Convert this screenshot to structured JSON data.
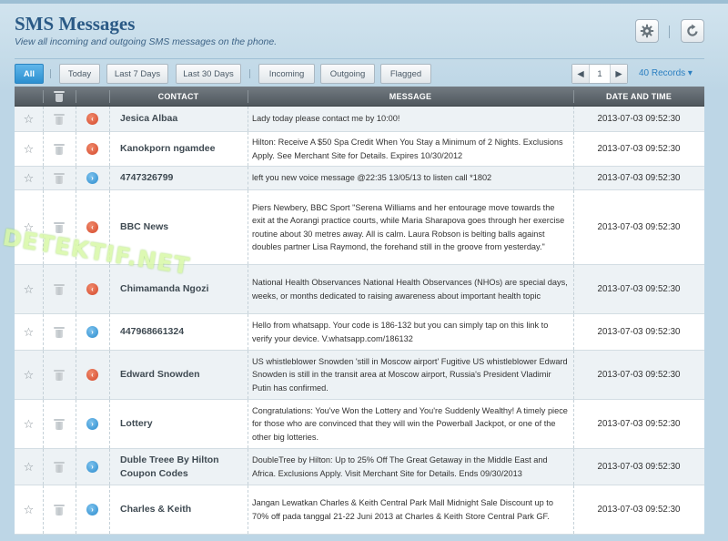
{
  "header": {
    "title": "SMS Messages",
    "subtitle": "View all incoming and outgoing SMS messages on the phone."
  },
  "icons": {
    "settings": "gear-icon",
    "refresh": "refresh-icon",
    "star": "star-icon",
    "trash": "trash-icon",
    "incoming": "incoming-arrow-icon",
    "outgoing": "outgoing-arrow-icon"
  },
  "colors": {
    "accent": "#2c8fd0",
    "incoming": "#d4472a",
    "outgoing": "#2b8bcd",
    "title": "#2b5a86"
  },
  "filters": {
    "all": "All",
    "today": "Today",
    "last7": "Last 7 Days",
    "last30": "Last 30 Days",
    "incoming": "Incoming",
    "outgoing": "Outgoing",
    "flagged": "Flagged",
    "active": "All"
  },
  "pager": {
    "page": "1",
    "records": "40 Records ▾"
  },
  "table": {
    "columns": {
      "contact": "CONTACT",
      "message": "MESSAGE",
      "datetime": "DATE AND TIME"
    },
    "rows": [
      {
        "direction": "incoming",
        "contact": "Jesica Albaa",
        "message": "Lady today please contact me by 10:00!",
        "datetime": "2013-07-03 09:52:30"
      },
      {
        "direction": "incoming",
        "contact": "Kanokporn ngamdee",
        "message": "Hilton: Receive A $50 Spa Credit When You Stay a Minimum of 2 Nights. Exclusions Apply. See Merchant Site for Details. Expires 10/30/2012",
        "datetime": "2013-07-03 09:52:30"
      },
      {
        "direction": "outgoing",
        "contact": "4747326799",
        "message": "left you new voice message @22:35 13/05/13 to listen call *1802",
        "datetime": "2013-07-03 09:52:30"
      },
      {
        "direction": "incoming",
        "contact": "BBC News",
        "message": "Piers Newbery, BBC Sport \"Serena Williams and her entourage move towards the exit at the Aorangi practice courts, while Maria Sharapova goes through her exercise routine about 30 metres away. All is calm. Laura Robson is belting balls against doubles partner Lisa Raymond, the forehand still in the groove from yesterday.\"",
        "datetime": "2013-07-03 09:52:30"
      },
      {
        "direction": "incoming",
        "contact": "Chimamanda Ngozi",
        "message": "National Health Observances National Health Observances (NHOs) are special days, weeks, or months dedicated to raising awareness about important health topic",
        "datetime": "2013-07-03 09:52:30"
      },
      {
        "direction": "outgoing",
        "contact": "447968661324",
        "message": "Hello from whatsapp. Your code is 186-132 but you can simply tap on this link to verify your device. V.whatsapp.com/186132",
        "datetime": "2013-07-03 09:52:30"
      },
      {
        "direction": "incoming",
        "contact": "Edward Snowden",
        "message": "US whistleblower Snowden 'still in Moscow airport' Fugitive US whistleblower Edward Snowden is still in the transit area at Moscow airport, Russia's President Vladimir Putin has confirmed.",
        "datetime": "2013-07-03 09:52:30"
      },
      {
        "direction": "outgoing",
        "contact": "Lottery",
        "message": "Congratulations: You've Won the Lottery and You're Suddenly Wealthy! A timely piece for those who are convinced that they will win the Powerball Jackpot, or one of the other big lotteries.",
        "datetime": "2013-07-03 09:52:30"
      },
      {
        "direction": "outgoing",
        "contact": "Duble Treee By Hilton Coupon Codes",
        "message": "DoubleTree by Hilton: Up to 25% Off The Great Getaway in the Middle East and Africa. Exclusions Apply. Visit Merchant Site for Details. Ends 09/30/2013",
        "datetime": "2013-07-03 09:52:30"
      },
      {
        "direction": "outgoing",
        "contact": "Charles & Keith",
        "message": "Jangan Lewatkan Charles & Keith Central Park Mall Midnight Sale Discount up to 70% off pada tanggal 21-22 Juni 2013 at Charles & Keith Store Central Park GF.",
        "datetime": "2013-07-03 09:52:30"
      }
    ]
  },
  "watermark": "DETEKTIF.NET"
}
